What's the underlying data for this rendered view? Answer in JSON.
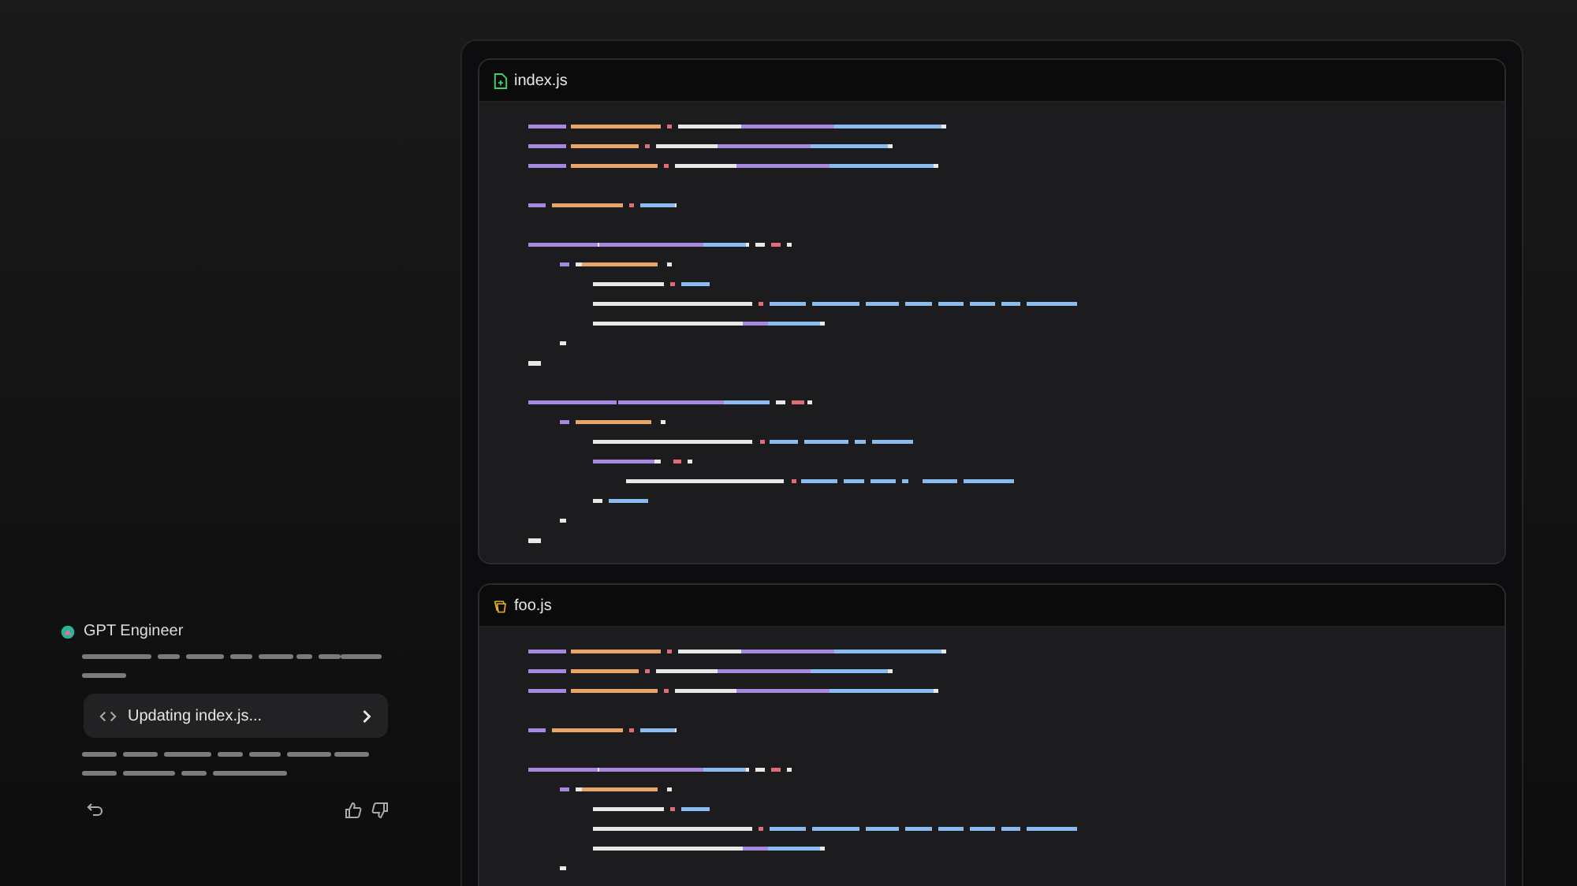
{
  "chat": {
    "author": "GPT Engineer",
    "status": "Updating index.js..."
  },
  "files": [
    {
      "name": "index.js",
      "kind": "file"
    },
    {
      "name": "foo.js",
      "kind": "component"
    }
  ]
}
